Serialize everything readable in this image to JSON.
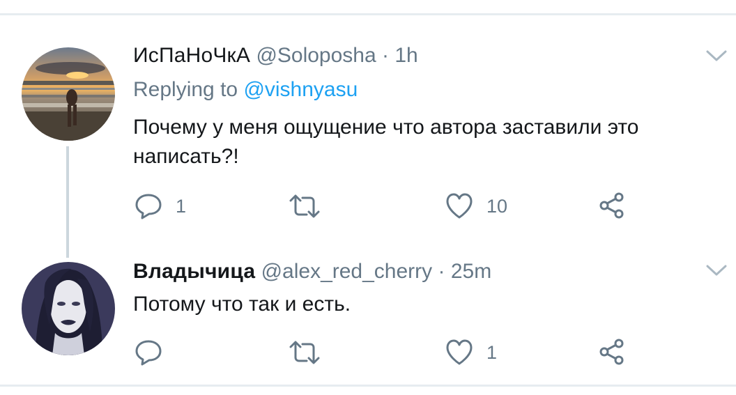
{
  "tweets": [
    {
      "name": "ИсПаНоЧкА",
      "handle": "@Soloposha",
      "separator": "·",
      "time": "1h",
      "reply_prefix": "Replying to",
      "reply_mention": "@vishnyasu",
      "text_line1": "Почему у меня ощущение что автора заставили это",
      "text_line2": "написать?!",
      "reply_count": "1",
      "like_count": "10",
      "avatar": "beach-sunset-photo"
    },
    {
      "name": "Владычица",
      "handle": "@alex_red_cherry",
      "separator": "·",
      "time": "25m",
      "text_line1": "Потому что так и есть.",
      "like_count": "1",
      "avatar": "pale-woman-illustration"
    }
  ],
  "icons": {
    "reply": "reply-bubble-icon",
    "retweet": "retweet-icon",
    "like": "heart-icon",
    "share": "share-icon",
    "menu": "chevron-down-icon"
  },
  "colors": {
    "text": "#14171a",
    "secondary": "#657786",
    "link": "#1da1f2",
    "divider": "#e6ecf0",
    "thread": "#ccd6dd"
  }
}
